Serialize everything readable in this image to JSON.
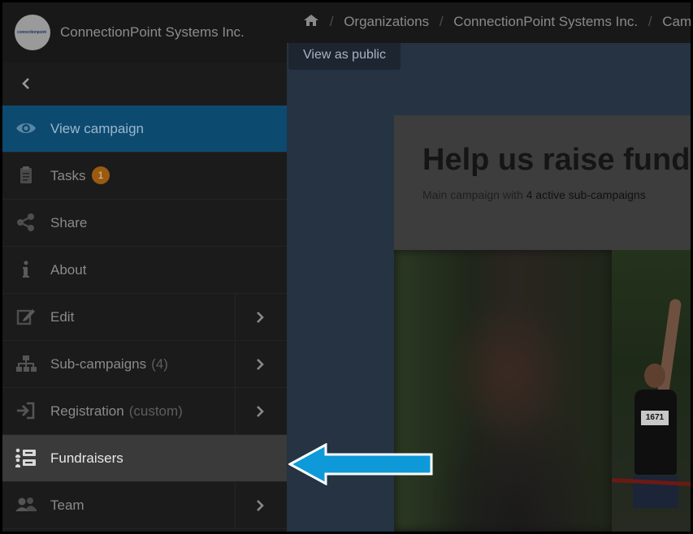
{
  "org": {
    "name": "ConnectionPoint Systems Inc.",
    "logo_text": "connectionpoint"
  },
  "breadcrumb": {
    "items": [
      "Organizations",
      "ConnectionPoint Systems Inc.",
      "Campa"
    ],
    "home_icon": "home-icon"
  },
  "nav": {
    "items": [
      {
        "label": "View campaign",
        "icon": "eye-icon",
        "state": "active"
      },
      {
        "label": "Tasks",
        "icon": "clipboard-icon",
        "badge": "1"
      },
      {
        "label": "Share",
        "icon": "share-icon"
      },
      {
        "label": "About",
        "icon": "info-icon"
      },
      {
        "label": "Edit",
        "icon": "edit-icon",
        "expandable": true
      },
      {
        "label": "Sub-campaigns",
        "meta": "(4)",
        "icon": "sitemap-icon",
        "expandable": true
      },
      {
        "label": "Registration",
        "meta": "(custom)",
        "icon": "sign-in-icon",
        "expandable": true
      },
      {
        "label": "Fundraisers",
        "icon": "list-icon",
        "state": "highlighted"
      },
      {
        "label": "Team",
        "icon": "users-icon",
        "expandable": true
      }
    ]
  },
  "main": {
    "view_public_label": "View as public",
    "campaign_title": "Help us raise funds",
    "campaign_sub_prefix": "Main campaign with",
    "campaign_sub_strong": "4 active sub-campaigns",
    "runner_bib": "1671"
  },
  "colors": {
    "active_nav": "#0d4a70",
    "highlight_nav": "#3a3a3a",
    "badge": "#9a5a10",
    "arrow": "#0e9ad8"
  }
}
